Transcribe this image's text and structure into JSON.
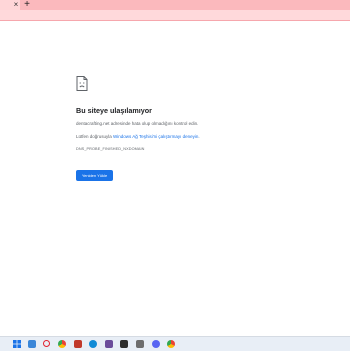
{
  "browser": {
    "tab_close": "×",
    "new_tab": "+"
  },
  "error": {
    "title": "Bu siteye ulaşılamıyor",
    "description": "dentacrafting.net adresinde hata olup olmadığını kontrol edin.",
    "suggest_prefix": "Lütfen doğrusuyla ",
    "suggest_link": "Windows Ağ Teşhisi'ni çalıştırmayı deneyin",
    "suggest_suffix": ".",
    "code": "DNS_PROBE_FINISHED_NXDOMAIN",
    "reload_label": "Yeniden Yükle"
  },
  "taskbar": {
    "icons": [
      {
        "name": "windows-start-icon",
        "color": "#1a73e8"
      },
      {
        "name": "file-explorer-icon",
        "color": "#3a86d8"
      },
      {
        "name": "opera-icon",
        "color": "#e3212f"
      },
      {
        "name": "chrome-icon",
        "color": "#34a853"
      },
      {
        "name": "shield-app-icon",
        "color": "#c0392b"
      },
      {
        "name": "edge-icon",
        "color": "#0f8ad6"
      },
      {
        "name": "media-icon",
        "color": "#6b4c9a"
      },
      {
        "name": "store-icon",
        "color": "#2d2d2d"
      },
      {
        "name": "game-icon",
        "color": "#6d6d6d"
      },
      {
        "name": "discord-icon",
        "color": "#5865f2"
      },
      {
        "name": "chrome-active-icon",
        "color": "#34a853"
      }
    ]
  }
}
